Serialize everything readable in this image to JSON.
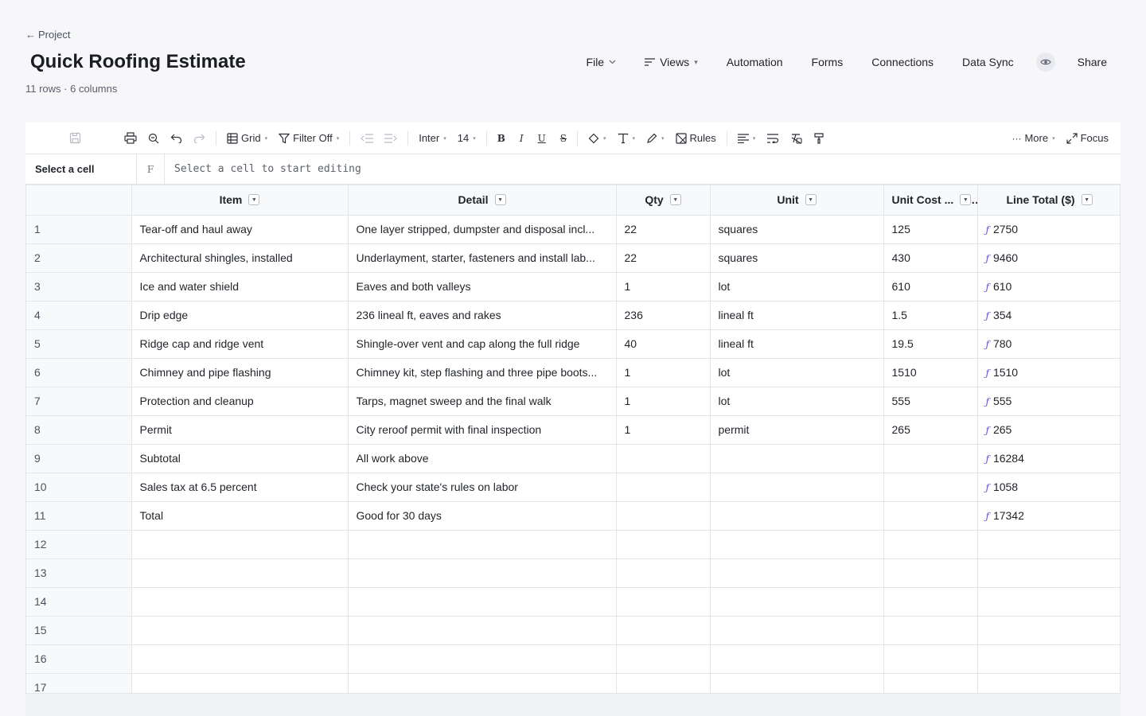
{
  "header": {
    "back_label": "Project",
    "title": "Quick Roofing Estimate",
    "subtitle": "11 rows · 6 columns"
  },
  "nav": {
    "file": "File",
    "views": "Views",
    "automation": "Automation",
    "forms": "Forms",
    "connections": "Connections",
    "data_sync": "Data Sync",
    "share": "Share"
  },
  "toolbar": {
    "grid": "Grid",
    "filter": "Filter Off",
    "font": "Inter",
    "font_size": "14",
    "bold": "B",
    "italic": "I",
    "underline": "U",
    "strike": "S",
    "rules": "Rules",
    "more": "More",
    "focus": "Focus"
  },
  "formula_bar": {
    "cell_ref": "Select a cell",
    "fx": "F",
    "placeholder": "Select a cell to start editing"
  },
  "grid": {
    "columns": [
      "Item",
      "Detail",
      "Qty",
      "Unit",
      "Unit Cost ...",
      "Line Total ($)"
    ],
    "rows": [
      {
        "n": "1",
        "item": "Tear-off and haul away",
        "detail": "One layer stripped, dumpster and disposal incl...",
        "qty": "22",
        "unit": "squares",
        "cost": "125",
        "total": "2750"
      },
      {
        "n": "2",
        "item": "Architectural shingles, installed",
        "detail": "Underlayment, starter, fasteners and install lab...",
        "qty": "22",
        "unit": "squares",
        "cost": "430",
        "total": "9460"
      },
      {
        "n": "3",
        "item": "Ice and water shield",
        "detail": "Eaves and both valleys",
        "qty": "1",
        "unit": "lot",
        "cost": "610",
        "total": "610"
      },
      {
        "n": "4",
        "item": "Drip edge",
        "detail": "236 lineal ft, eaves and rakes",
        "qty": "236",
        "unit": "lineal ft",
        "cost": "1.5",
        "total": "354"
      },
      {
        "n": "5",
        "item": "Ridge cap and ridge vent",
        "detail": "Shingle-over vent and cap along the full ridge",
        "qty": "40",
        "unit": "lineal ft",
        "cost": "19.5",
        "total": "780"
      },
      {
        "n": "6",
        "item": "Chimney and pipe flashing",
        "detail": "Chimney kit, step flashing and three pipe boots...",
        "qty": "1",
        "unit": "lot",
        "cost": "1510",
        "total": "1510"
      },
      {
        "n": "7",
        "item": "Protection and cleanup",
        "detail": "Tarps, magnet sweep and the final walk",
        "qty": "1",
        "unit": "lot",
        "cost": "555",
        "total": "555"
      },
      {
        "n": "8",
        "item": "Permit",
        "detail": "City reroof permit with final inspection",
        "qty": "1",
        "unit": "permit",
        "cost": "265",
        "total": "265"
      },
      {
        "n": "9",
        "item": "Subtotal",
        "detail": "All work above",
        "qty": "",
        "unit": "",
        "cost": "",
        "total": "16284"
      },
      {
        "n": "10",
        "item": "Sales tax at 6.5 percent",
        "detail": "Check your state's rules on labor",
        "qty": "",
        "unit": "",
        "cost": "",
        "total": "1058"
      },
      {
        "n": "11",
        "item": "Total",
        "detail": "Good for 30 days",
        "qty": "",
        "unit": "",
        "cost": "",
        "total": "17342"
      },
      {
        "n": "12",
        "item": "",
        "detail": "",
        "qty": "",
        "unit": "",
        "cost": "",
        "total": ""
      },
      {
        "n": "13",
        "item": "",
        "detail": "",
        "qty": "",
        "unit": "",
        "cost": "",
        "total": ""
      },
      {
        "n": "14",
        "item": "",
        "detail": "",
        "qty": "",
        "unit": "",
        "cost": "",
        "total": ""
      },
      {
        "n": "15",
        "item": "",
        "detail": "",
        "qty": "",
        "unit": "",
        "cost": "",
        "total": ""
      },
      {
        "n": "16",
        "item": "",
        "detail": "",
        "qty": "",
        "unit": "",
        "cost": "",
        "total": ""
      },
      {
        "n": "17",
        "item": "",
        "detail": "",
        "qty": "",
        "unit": "",
        "cost": "",
        "total": ""
      }
    ]
  },
  "colors": {
    "accent": "#5a4de0",
    "background": "#f7f7f9"
  }
}
